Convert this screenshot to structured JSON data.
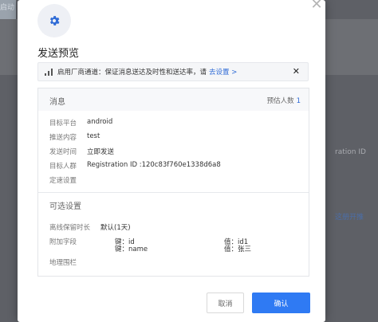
{
  "background": {
    "topleft_text": "启动",
    "registration_fragment": "ration ID",
    "link_fragment": "这册开推"
  },
  "modal": {
    "gear_icon": "gear-icon",
    "title": "发送预览",
    "notice": {
      "text": "启用厂商通道：保证消息送达及时性和送达率，请",
      "link": "去设置 >",
      "close": "✕"
    },
    "message": {
      "section_title": "消息",
      "estimate_label": "预估人数",
      "estimate_count": "1",
      "fields": [
        {
          "label": "目标平台",
          "value": "android"
        },
        {
          "label": "推送内容",
          "value": "test"
        },
        {
          "label": "发送时间",
          "value": "立即发送"
        },
        {
          "label": "目标人群",
          "value": "Registration ID :120c83f760e1338d6a8"
        },
        {
          "label": "定速设置",
          "value": ""
        }
      ]
    },
    "optional": {
      "section_title": "可选设置",
      "offline_label": "离线保留时长",
      "offline_value": "默认(1天)",
      "extra_label": "附加字段",
      "extras": [
        {
          "key": "键：id",
          "value": "值：id1"
        },
        {
          "key": "键：name",
          "value": "值：张三"
        }
      ],
      "geofence_label": "地理围栏"
    },
    "buttons": {
      "cancel": "取消",
      "ok": "确认"
    },
    "colors": {
      "accent": "#2f7af3",
      "link": "#2f6bd6"
    }
  }
}
